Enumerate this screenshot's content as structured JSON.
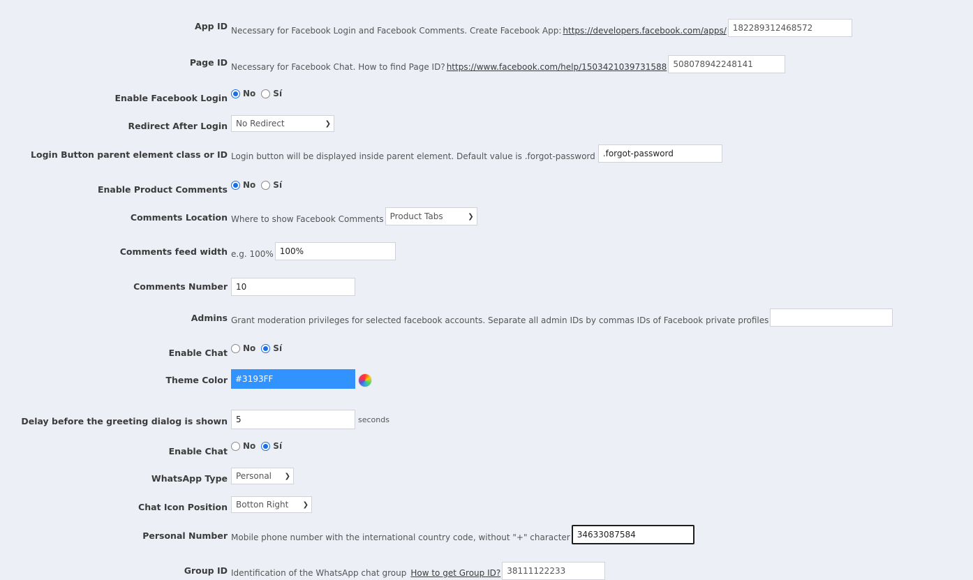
{
  "theme_color": "#3193FF",
  "fields": {
    "app_id": {
      "label": "App ID",
      "desc": "Necessary for Facebook Login and Facebook Comments. Create Facebook App:",
      "link": "https://developers.facebook.com/apps/",
      "value": "182289312468572"
    },
    "page_id": {
      "label": "Page ID",
      "desc": "Necessary for Facebook Chat. How to find Page ID?",
      "link": "https://www.facebook.com/help/1503421039731588",
      "value": "508078942248141"
    },
    "enable_login": {
      "label": "Enable Facebook Login",
      "opt_no": "No",
      "opt_yes": "Sí"
    },
    "redirect": {
      "label": "Redirect After Login",
      "value": "No Redirect"
    },
    "login_parent": {
      "label": "Login Button parent element class or ID",
      "desc": "Login button will be displayed inside parent element. Default value is .forgot-password",
      "value": ".forgot-password"
    },
    "enable_comments": {
      "label": "Enable Product Comments",
      "opt_no": "No",
      "opt_yes": "Sí"
    },
    "comments_location": {
      "label": "Comments Location",
      "desc": "Where to show Facebook Comments",
      "value": "Product Tabs"
    },
    "feed_width": {
      "label": "Comments feed width",
      "desc": "e.g. 100%",
      "value": "100%"
    },
    "comments_number": {
      "label": "Comments Number",
      "value": "10"
    },
    "admins": {
      "label": "Admins",
      "desc": "Grant moderation privileges for selected facebook accounts. Separate all admin IDs by commas IDs of Facebook private profiles",
      "value": ""
    },
    "enable_chat_fb": {
      "label": "Enable Chat",
      "opt_no": "No",
      "opt_yes": "Sí"
    },
    "theme_color": {
      "label": "Theme Color",
      "value": "#3193FF"
    },
    "delay": {
      "label": "Delay before the greeting dialog is shown",
      "value": "5",
      "unit": "seconds"
    },
    "enable_chat_wa": {
      "label": "Enable Chat",
      "opt_no": "No",
      "opt_yes": "Sí"
    },
    "whatsapp_type": {
      "label": "WhatsApp Type",
      "value": "Personal"
    },
    "chat_icon_position": {
      "label": "Chat Icon Position",
      "value": "Botton Right"
    },
    "personal_number": {
      "label": "Personal Number",
      "desc": "Mobile phone number with the international country code, without \"+\" character",
      "value": "34633087584"
    },
    "group_id": {
      "label": "Group ID",
      "desc": "Identification of the WhatsApp chat group",
      "link": "How to get Group ID?",
      "value": "38111122233"
    }
  }
}
